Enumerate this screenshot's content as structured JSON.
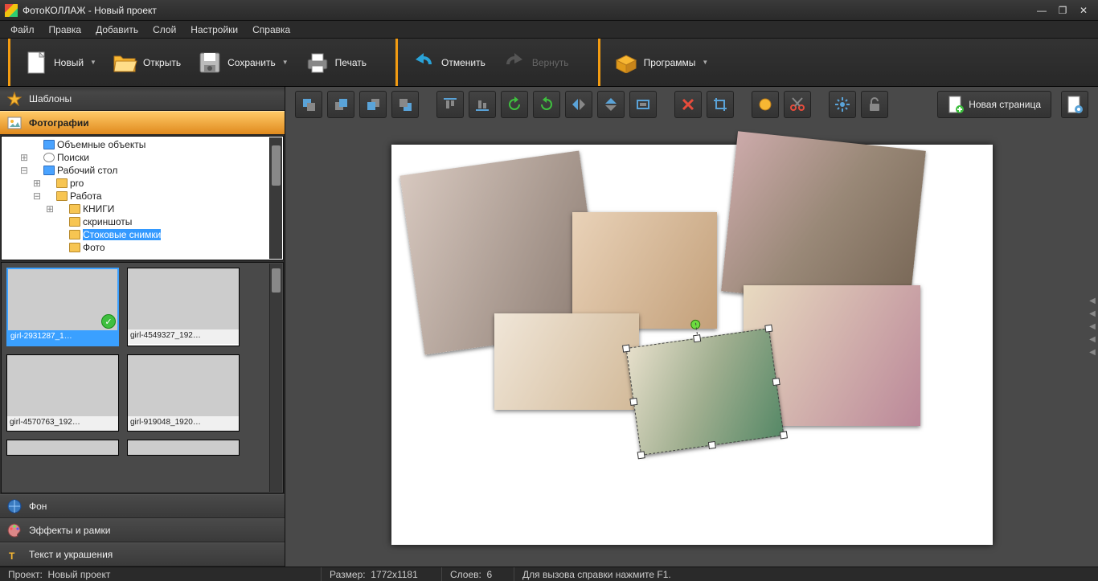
{
  "window_title": "ФотоКОЛЛАЖ - Новый проект",
  "menubar": [
    "Файл",
    "Правка",
    "Добавить",
    "Слой",
    "Настройки",
    "Справка"
  ],
  "toolbar": {
    "new": "Новый",
    "open": "Открыть",
    "save": "Сохранить",
    "print": "Печать",
    "undo": "Отменить",
    "redo": "Вернуть",
    "programs": "Программы"
  },
  "left_panel": {
    "templates": "Шаблоны",
    "photos": "Фотографии",
    "background": "Фон",
    "effects": "Эффекты и рамки",
    "text": "Текст и украшения",
    "tree": {
      "n0": "Объемные объекты",
      "n1": "Поиски",
      "n2": "Рабочий стол",
      "n3": "pro",
      "n4": "Работа",
      "n5": "КНИГИ",
      "n6": "скриншоты",
      "n7": "Стоковые снимки",
      "n8": "Фото"
    },
    "thumbs": {
      "t0": "girl-2931287_1…",
      "t1": "girl-4549327_192…",
      "t2": "girl-4570763_192…",
      "t3": "girl-919048_1920…"
    }
  },
  "canvas_toolbar": {
    "newpage": "Новая страница"
  },
  "status": {
    "project_label": "Проект:",
    "project_name": "Новый проект",
    "size_label": "Размер:",
    "size_value": "1772x1181",
    "layers_label": "Слоев:",
    "layers_value": "6",
    "help": "Для вызова справки нажмите F1."
  }
}
